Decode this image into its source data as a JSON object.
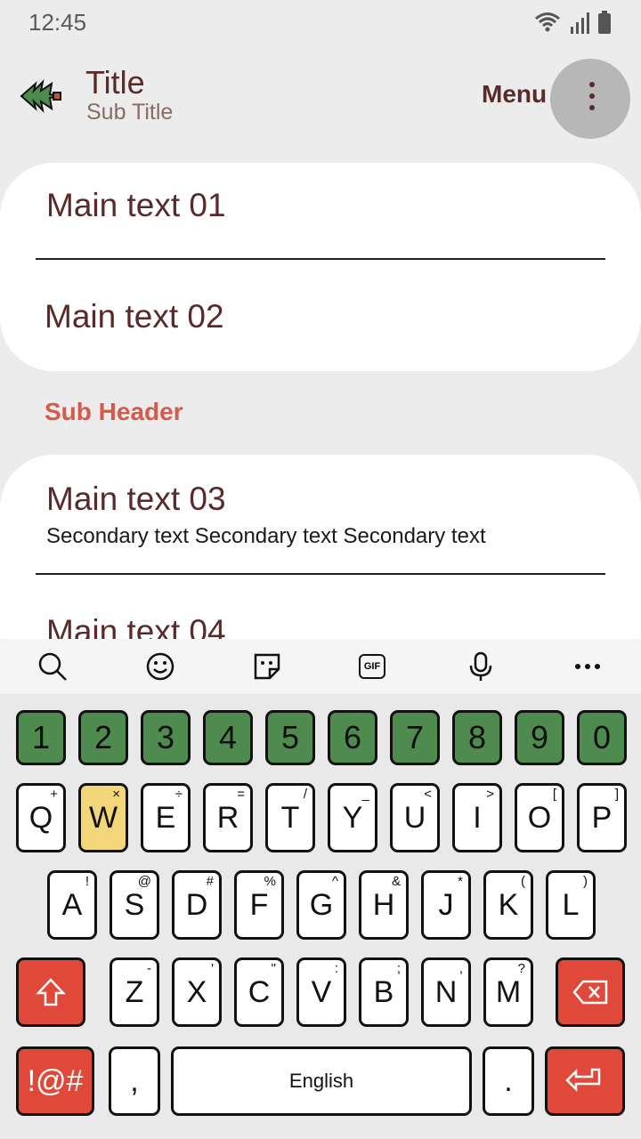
{
  "status": {
    "time": "12:45"
  },
  "appbar": {
    "title": "Title",
    "subtitle": "Sub Title",
    "menu_label": "Menu"
  },
  "list": {
    "item1": "Main text 01",
    "item2": "Main text 02",
    "sub_header": "Sub Header",
    "item3": "Main text 03",
    "item3_secondary": "Secondary text Secondary text Secondary text",
    "item4": "Main text 04"
  },
  "keyboard": {
    "toolbar": [
      "search-icon",
      "emoji-icon",
      "sticker-icon",
      "gif-icon",
      "mic-icon",
      "more-icon"
    ],
    "gif_label": "GIF",
    "numbers": [
      "1",
      "2",
      "3",
      "4",
      "5",
      "6",
      "7",
      "8",
      "9",
      "0"
    ],
    "row1": [
      {
        "k": "Q",
        "h": "+"
      },
      {
        "k": "W",
        "h": "×"
      },
      {
        "k": "E",
        "h": "÷"
      },
      {
        "k": "R",
        "h": "="
      },
      {
        "k": "T",
        "h": "/"
      },
      {
        "k": "Y",
        "h": "_"
      },
      {
        "k": "U",
        "h": "<"
      },
      {
        "k": "I",
        "h": ">"
      },
      {
        "k": "O",
        "h": "["
      },
      {
        "k": "P",
        "h": "]"
      }
    ],
    "row2": [
      {
        "k": "A",
        "h": "!"
      },
      {
        "k": "S",
        "h": "@"
      },
      {
        "k": "D",
        "h": "#"
      },
      {
        "k": "F",
        "h": "%"
      },
      {
        "k": "G",
        "h": "^"
      },
      {
        "k": "H",
        "h": "&"
      },
      {
        "k": "J",
        "h": "*"
      },
      {
        "k": "K",
        "h": "("
      },
      {
        "k": "L",
        "h": ")"
      }
    ],
    "row3": [
      {
        "k": "Z",
        "h": "-"
      },
      {
        "k": "X",
        "h": "'"
      },
      {
        "k": "C",
        "h": "\""
      },
      {
        "k": "V",
        "h": ":"
      },
      {
        "k": "B",
        "h": ";"
      },
      {
        "k": "N",
        "h": ","
      },
      {
        "k": "M",
        "h": "?"
      }
    ],
    "symbols_label": "!@#",
    "comma": ",",
    "space_label": "English",
    "period": ".",
    "colors": {
      "number_key": "#4f8a4f",
      "action_key": "#e0493a",
      "highlight_key": "#f3d57a"
    }
  }
}
